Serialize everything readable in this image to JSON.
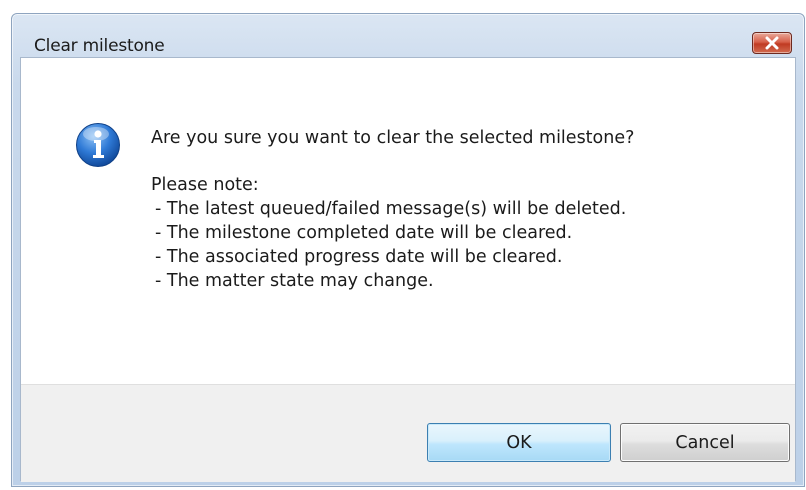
{
  "dialog": {
    "title": "Clear milestone",
    "close_icon": "close-icon",
    "icon": "info-icon",
    "question": "Are you sure you want to clear the selected milestone?",
    "note_heading": "Please note:",
    "notes": [
      "- The latest queued/failed message(s) will be deleted.",
      "- The milestone completed date will be cleared.",
      "- The associated progress date will be cleared.",
      "- The matter state may change."
    ],
    "buttons": {
      "ok_label": "OK",
      "cancel_label": "Cancel"
    }
  },
  "colors": {
    "close_button": "#c9452d",
    "ok_button_border": "#3c7fb1",
    "info_icon": "#1f65c4"
  }
}
